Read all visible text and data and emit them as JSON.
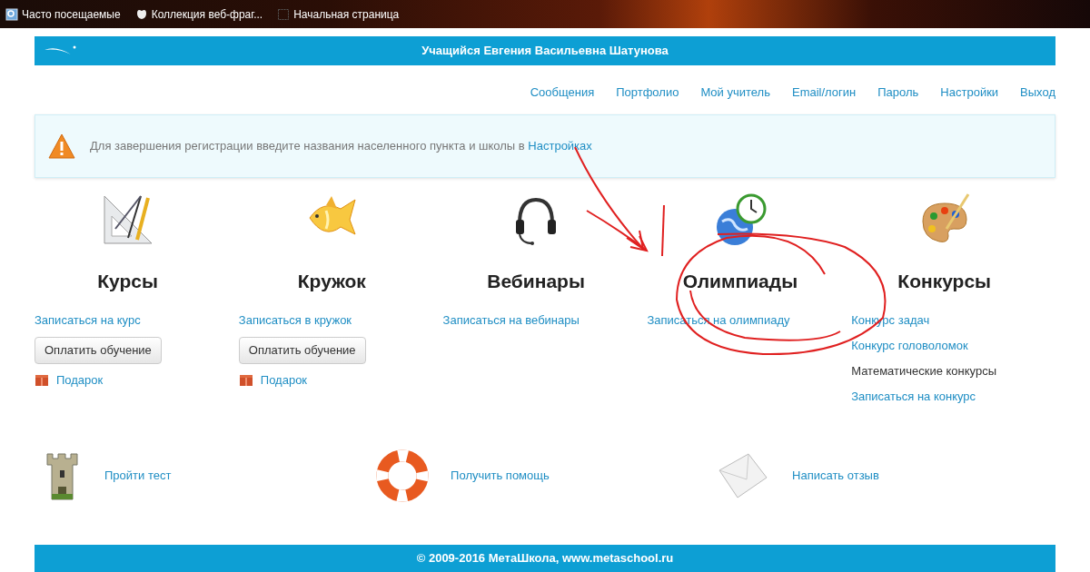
{
  "bookmarks": [
    {
      "kind": "page",
      "label": "Часто посещаемые"
    },
    {
      "kind": "slice",
      "label": "Коллекция веб-фраг..."
    },
    {
      "kind": "blank",
      "label": "Начальная страница"
    }
  ],
  "header": {
    "title": "Учащийся Евгения Васильевна Шатунова"
  },
  "nav": [
    "Сообщения",
    "Портфолио",
    "Мой учитель",
    "Email/логин",
    "Пароль",
    "Настройки",
    "Выход"
  ],
  "alert": {
    "text": "Для завершения регистрации введите названия населенного пункта и школы в ",
    "link": "Настройках"
  },
  "sections": [
    {
      "kind": "drafting",
      "title": "Курсы",
      "items": [
        {
          "kind": "link",
          "text": "Записаться на курс"
        },
        {
          "kind": "button",
          "text": "Оплатить обучение"
        },
        {
          "kind": "gift",
          "text": "Подарок"
        }
      ]
    },
    {
      "kind": "fish",
      "title": "Кружок",
      "items": [
        {
          "kind": "link",
          "text": "Записаться в кружок"
        },
        {
          "kind": "button",
          "text": "Оплатить обучение"
        },
        {
          "kind": "gift",
          "text": "Подарок"
        }
      ]
    },
    {
      "kind": "headset",
      "title": "Вебинары",
      "items": [
        {
          "kind": "link",
          "text": "Записаться на вебинары"
        }
      ]
    },
    {
      "kind": "globe",
      "title": "Олимпиады",
      "items": [
        {
          "kind": "link",
          "text": "Записаться на олимпиаду"
        }
      ]
    },
    {
      "kind": "palette",
      "title": "Конкурсы",
      "items": [
        {
          "kind": "link",
          "text": "Конкурс задач"
        },
        {
          "kind": "link",
          "text": "Конкурс головоломок"
        },
        {
          "kind": "text",
          "text": "Математические конкурсы"
        },
        {
          "kind": "link",
          "text": "Записаться на конкурс"
        }
      ]
    }
  ],
  "actions": [
    {
      "kind": "tower",
      "text": "Пройти тест"
    },
    {
      "kind": "lifebuoy",
      "text": "Получить помощь"
    },
    {
      "kind": "envelope",
      "text": "Написать отзыв"
    }
  ],
  "footer": "© 2009-2016 МетаШкола, www.metaschool.ru",
  "markup": [
    {
      "kind": "arrow"
    },
    {
      "kind": "arrow"
    },
    {
      "kind": "line"
    },
    {
      "kind": "circle"
    }
  ]
}
